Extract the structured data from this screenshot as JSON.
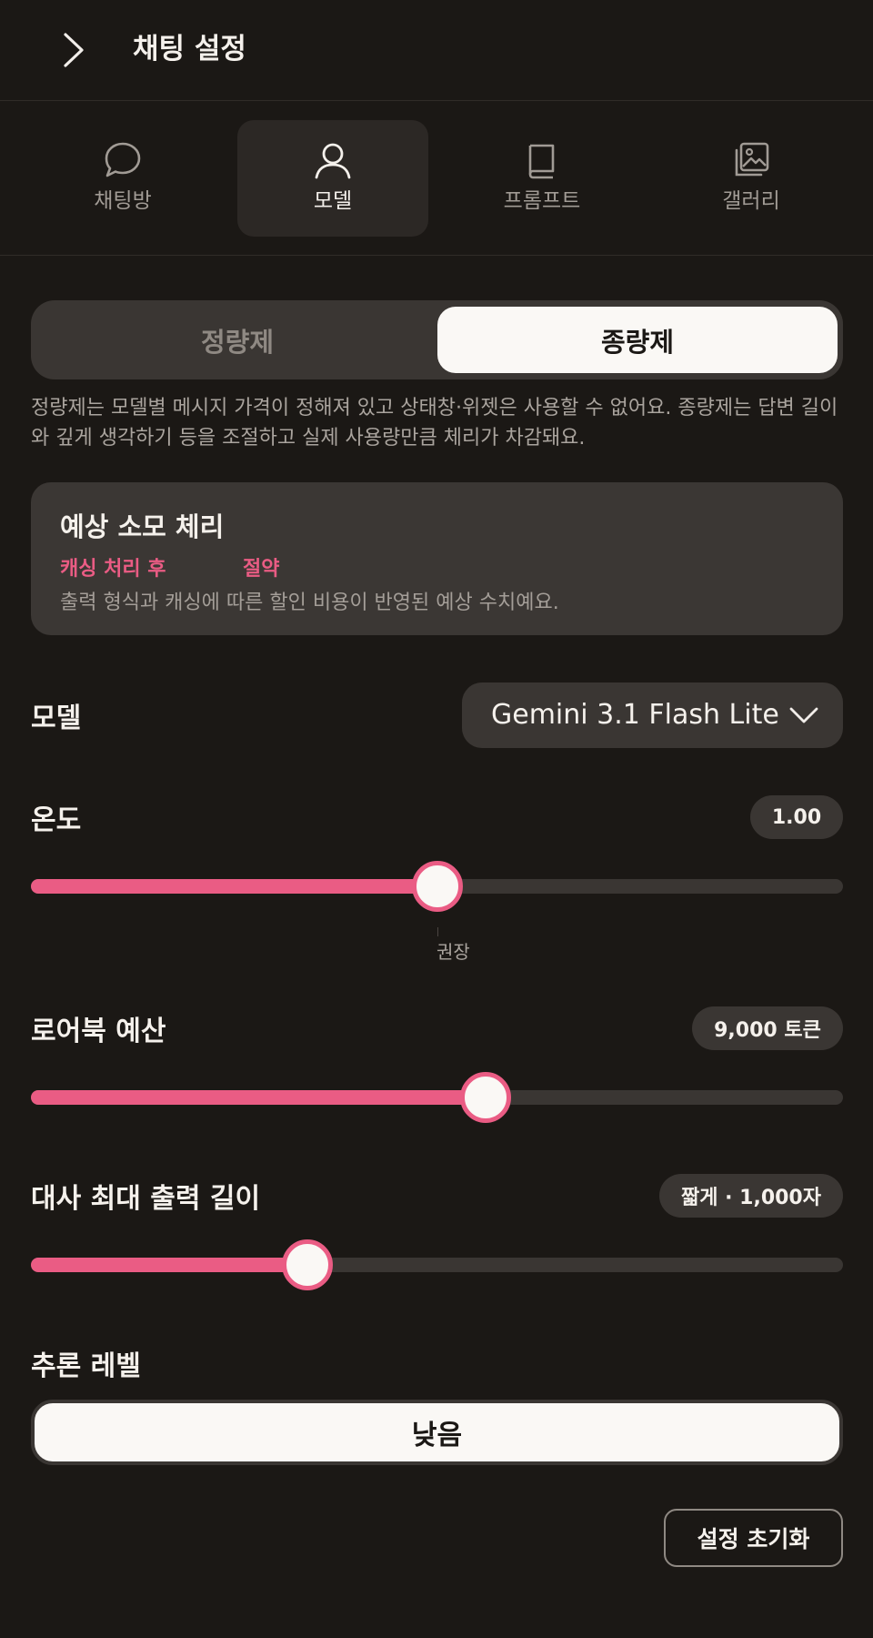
{
  "header": {
    "title": "채팅 설정"
  },
  "tabs": [
    {
      "label": "채팅방",
      "icon": "chat-bubble-icon",
      "active": false
    },
    {
      "label": "모델",
      "icon": "user-icon",
      "active": true
    },
    {
      "label": "프롬프트",
      "icon": "book-icon",
      "active": false
    },
    {
      "label": "갤러리",
      "icon": "gallery-icon",
      "active": false
    }
  ],
  "plan": {
    "options": [
      "정량제",
      "종량제"
    ],
    "selected": "종량제",
    "description": "정량제는 모델별 메시지 가격이 정해져 있고 상태창·위젯은 사용할 수 없어요. 종량제는 답변 길이와 깊게 생각하기 등을 조절하고 실제 사용량만큼 체리가 차감돼요."
  },
  "cost": {
    "title": "예상 소모 체리",
    "after_caching": "캐싱 처리 후",
    "savings": "절약",
    "note": "출력 형식과 캐싱에 따른 할인 비용이 반영된 예상 수치예요."
  },
  "model": {
    "label": "모델",
    "value": "Gemini 3.1 Flash Lite"
  },
  "temperature": {
    "label": "온도",
    "value": "1.00",
    "fraction": 0.5,
    "recommended_label": "권장"
  },
  "lorebook": {
    "label": "로어북 예산",
    "value": "9,000 토큰",
    "fraction": 0.56
  },
  "output_length": {
    "label": "대사 최대 출력 길이",
    "value": "짧게 · 1,000자",
    "fraction": 0.34
  },
  "reasoning": {
    "label": "추론 레벨",
    "value": "낮음"
  },
  "reset": {
    "label": "설정 초기화"
  },
  "colors": {
    "accent": "#ea5c84",
    "background": "#1b1815",
    "surface": "#3a3633"
  }
}
